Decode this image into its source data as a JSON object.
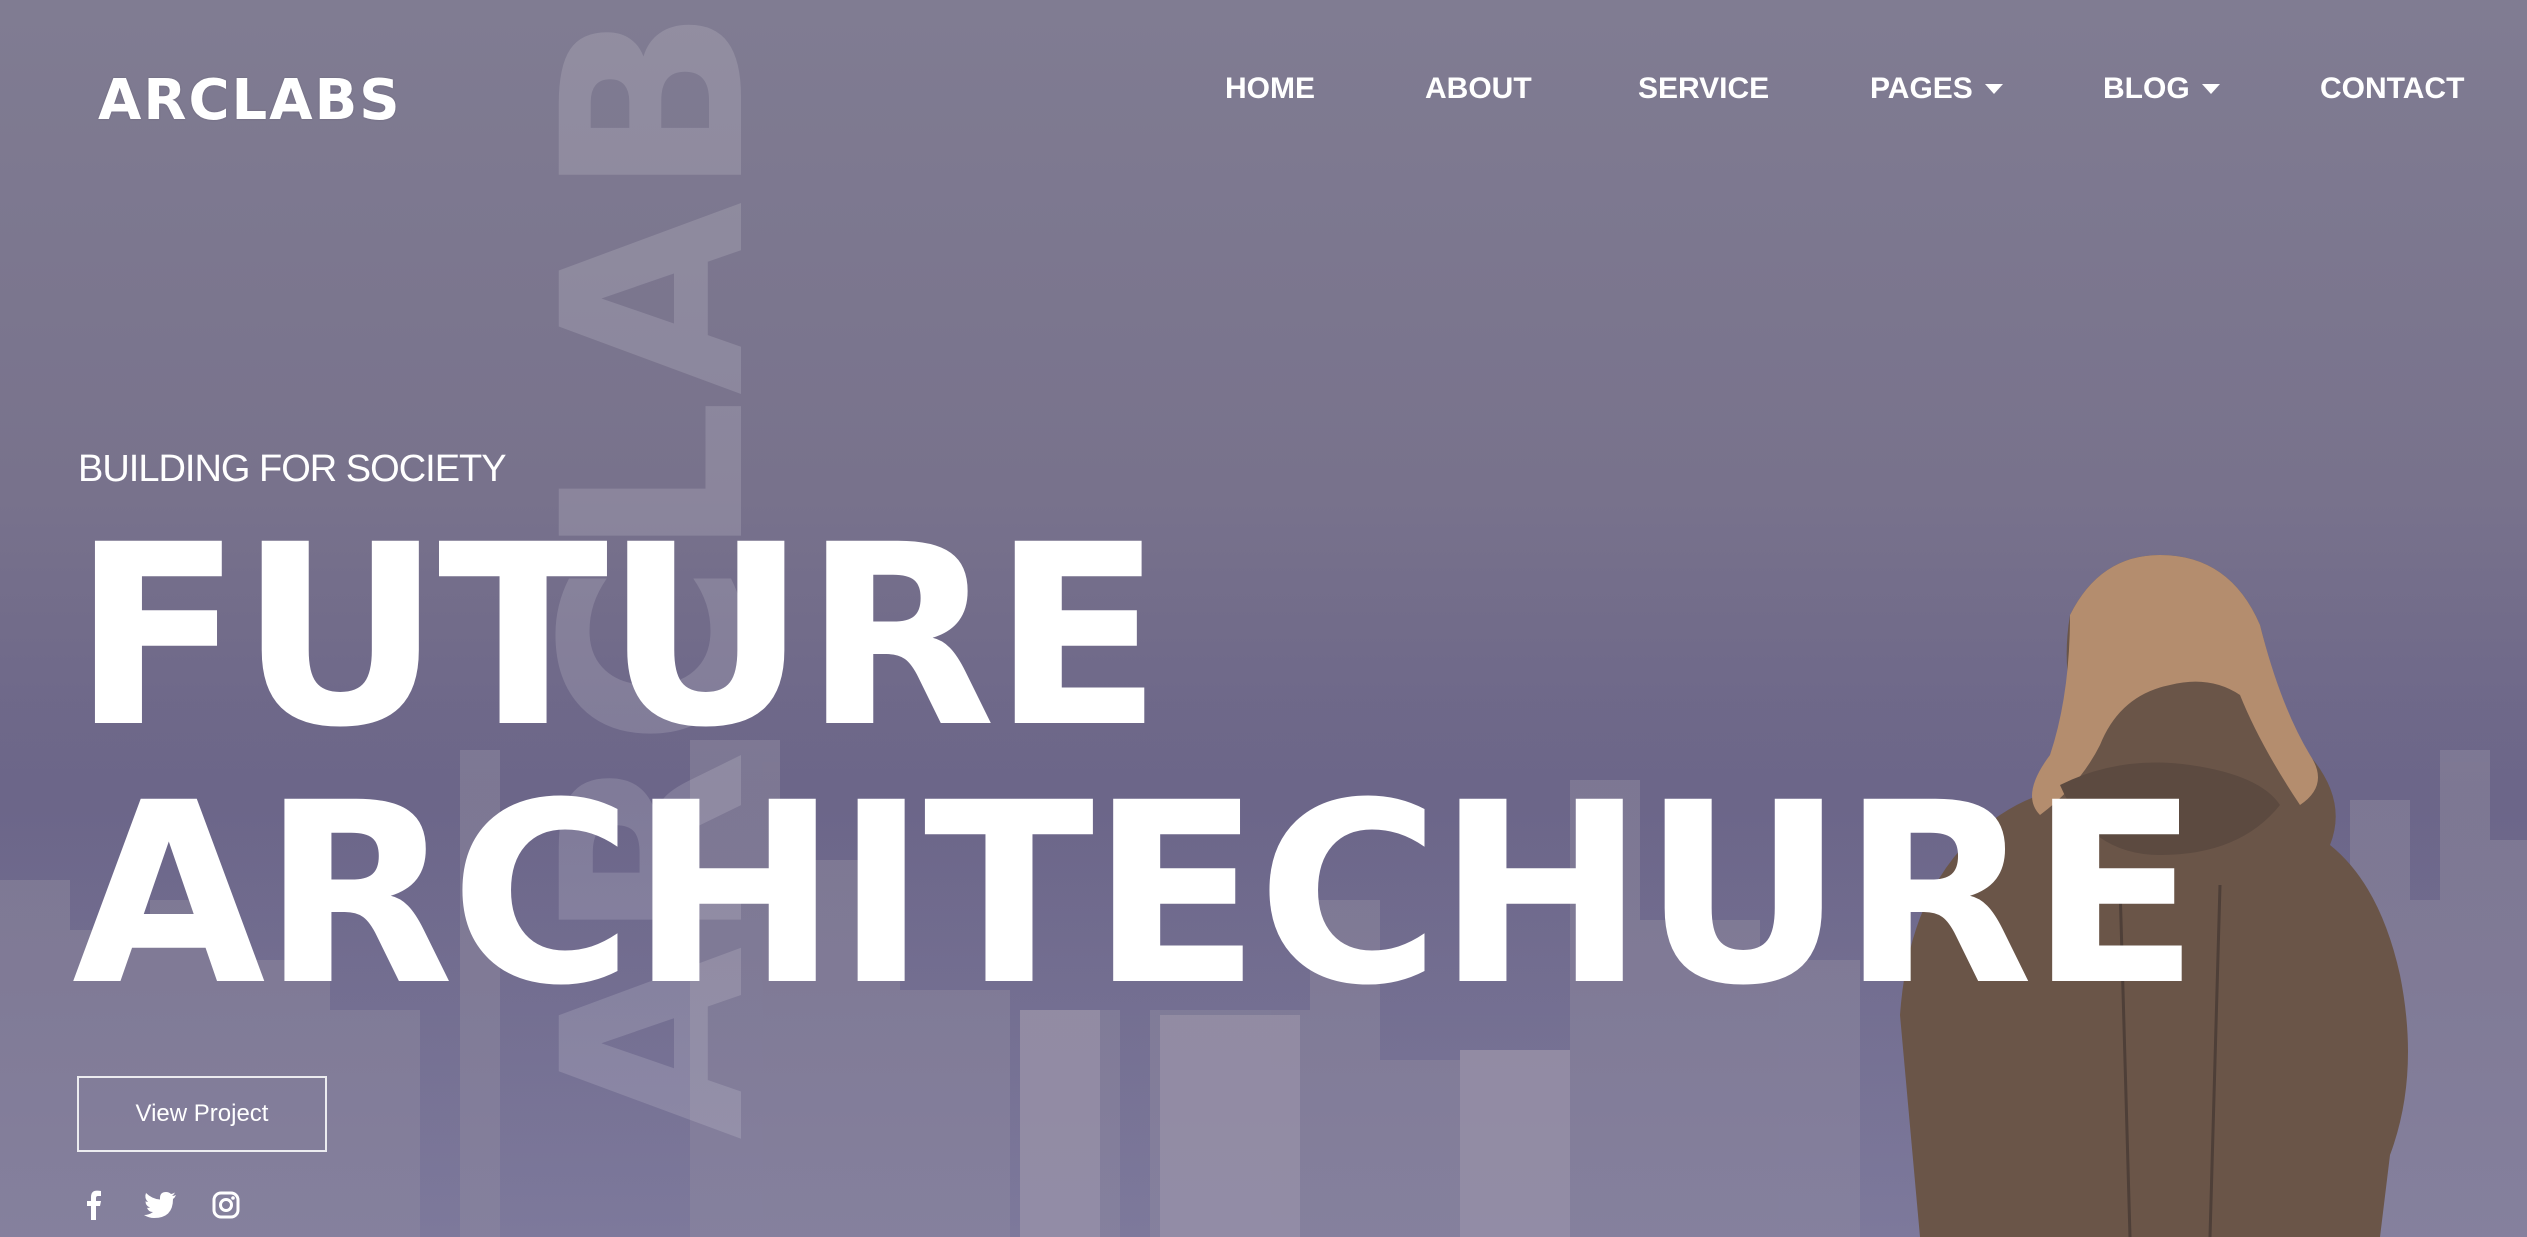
{
  "brand": {
    "logo": "ARCLABS",
    "watermark": "ARCLABS"
  },
  "nav": {
    "items": [
      {
        "label": "HOME",
        "dropdown": false
      },
      {
        "label": "ABOUT",
        "dropdown": false
      },
      {
        "label": "SERVICE",
        "dropdown": false
      },
      {
        "label": "PAGES",
        "dropdown": true
      },
      {
        "label": "BLOG",
        "dropdown": true
      },
      {
        "label": "CONTACT",
        "dropdown": false
      }
    ]
  },
  "hero": {
    "tagline": "BUILDING FOR SOCIETY",
    "headline_line1": "FUTURE",
    "headline_line2": "ARCHITECHURE",
    "cta_label": "View Project"
  },
  "social": {
    "icons": [
      "facebook-icon",
      "twitter-icon",
      "instagram-icon"
    ]
  },
  "colors": {
    "text": "#ffffff",
    "overlay": "#7a7590"
  }
}
